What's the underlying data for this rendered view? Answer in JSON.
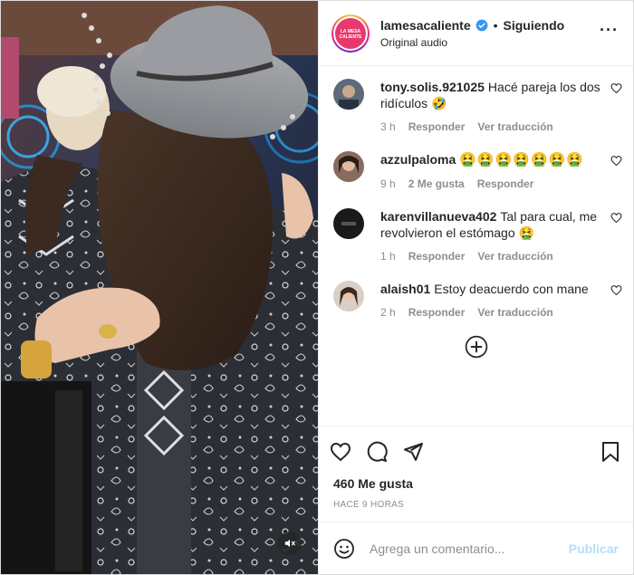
{
  "header": {
    "username": "lamesacaliente",
    "separator": "•",
    "follow_label": "Siguiendo",
    "audio": "Original audio",
    "more": "···",
    "avatar_text": "LA MESA CALIENTE"
  },
  "comments": [
    {
      "username": "tony.solis.921025",
      "text": "Hacé pareja los dos ridículos 🤣",
      "time": "3 h",
      "likes": "",
      "reply": "Responder",
      "translate": "Ver traducción"
    },
    {
      "username": "azzulpaloma",
      "text": "🤮🤮🤮🤮🤮🤮🤮",
      "time": "9 h",
      "likes": "2 Me gusta",
      "reply": "Responder",
      "translate": ""
    },
    {
      "username": "karenvillanueva402",
      "text": "Tal para cual, me revolvieron el estómago 🤮",
      "time": "1 h",
      "likes": "",
      "reply": "Responder",
      "translate": "Ver traducción"
    },
    {
      "username": "alaish01",
      "text": "Estoy deacuerdo con mane",
      "time": "2 h",
      "likes": "",
      "reply": "Responder",
      "translate": "Ver traducción"
    }
  ],
  "post": {
    "likes": "460 Me gusta",
    "timestamp": "HACE 9 HORAS"
  },
  "composer": {
    "placeholder": "Agrega un comentario...",
    "publish_label": "Publicar"
  },
  "colors": {
    "verified": "#3897f0",
    "publish_disabled": "#b2dffc",
    "meta_gray": "#8e8e8e",
    "brand_pink": "#e8386d"
  }
}
